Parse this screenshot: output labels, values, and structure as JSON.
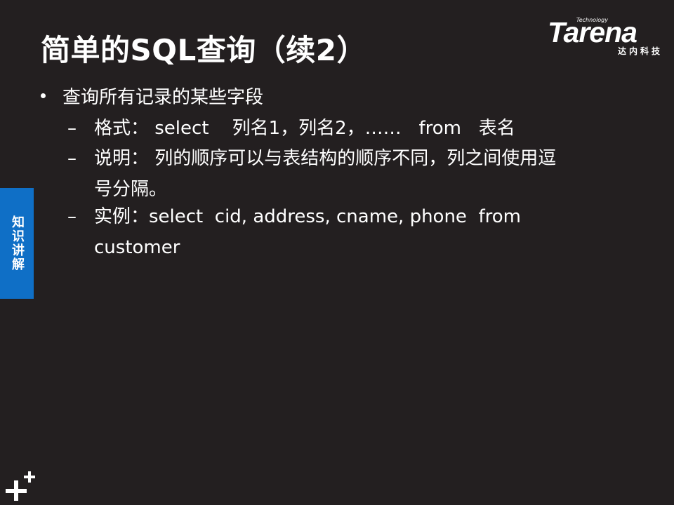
{
  "slide": {
    "title": "简单的SQL查询（续2）"
  },
  "logo": {
    "small_text": "Technology",
    "word": "Tarena",
    "sub_text": "达内科技"
  },
  "side_tab": {
    "label": "知识讲解"
  },
  "content": {
    "bullet": "查询所有记录的某些字段",
    "sub_items": [
      {
        "dash": "–",
        "line1": "格式： select    列名1，列名2，……   from   表名",
        "line2": ""
      },
      {
        "dash": "–",
        "line1": "说明： 列的顺序可以与表结构的顺序不同，列之间使用逗",
        "line2": "号分隔。"
      },
      {
        "dash": "–",
        "line1": "实例：select  cid, address, cname, phone  from",
        "line2": "customer"
      }
    ]
  },
  "colors": {
    "background": "#231f20",
    "accent_blue": "#0f6fc6",
    "text": "#ffffff"
  },
  "icons": {
    "bottom_left": "plus-decoration-icon"
  }
}
